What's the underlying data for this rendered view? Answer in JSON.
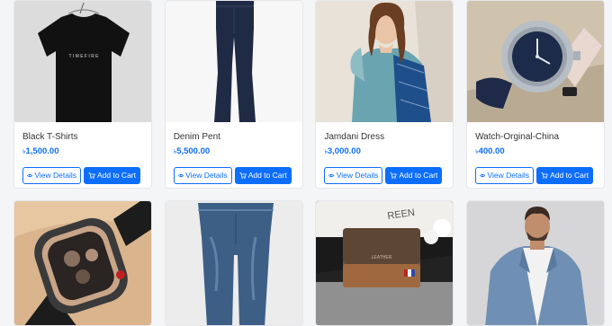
{
  "products": [
    {
      "title": "Black T-Shirts",
      "currency": "৳",
      "price": "1,500.00",
      "image": "black-tshirt"
    },
    {
      "title": "Denim Pent",
      "currency": "৳",
      "price": "5,500.00",
      "image": "denim-pants"
    },
    {
      "title": "Jamdani Dress",
      "currency": "৳",
      "price": "3,000.00",
      "image": "jamdani-dress"
    },
    {
      "title": "Watch-Orginal-China",
      "currency": "৳",
      "price": "400.00",
      "image": "silver-watch"
    }
  ],
  "products_row2": [
    {
      "image": "skeleton-watch"
    },
    {
      "image": "jeans"
    },
    {
      "image": "leather-wallet"
    },
    {
      "image": "denim-jacket"
    }
  ],
  "buttons": {
    "view": "View Details",
    "cart": "Add to Cart"
  },
  "tshirt_print": "T I M E   F I R E",
  "wallet_print": "LEATHER",
  "wallpaper_text": "REEN",
  "colors": {
    "accent": "#0d6efd"
  }
}
